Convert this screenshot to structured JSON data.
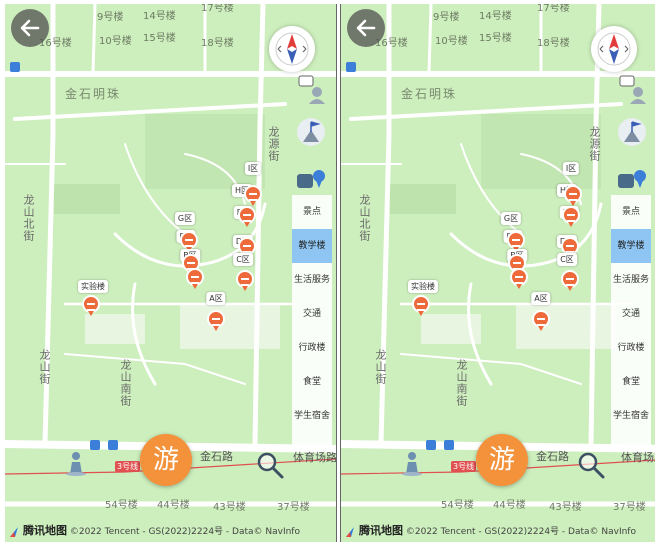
{
  "map": {
    "buildings": [
      "9号楼",
      "14号楼",
      "17号楼",
      "10号楼",
      "15号楼",
      "18号楼",
      "16号楼"
    ],
    "area_name": "金石明珠",
    "streets": {
      "longyuan": "龙源街",
      "longshan_north": "龙山北街",
      "longshan": "龙山街",
      "longshan_south": "龙山南街",
      "jinshi_road": "金石路",
      "tiyu_road": "体育场路"
    },
    "bottom_buildings": [
      "54号楼",
      "44号楼",
      "43号楼",
      "37号楼"
    ],
    "metro_tag": "3号线",
    "pois": [
      {
        "label": "I区"
      },
      {
        "label": "H区"
      },
      {
        "label": "F区"
      },
      {
        "label": "G区"
      },
      {
        "label": "E区"
      },
      {
        "label": "D区"
      },
      {
        "label": "B区"
      },
      {
        "label": "C区"
      },
      {
        "label": "实验楼"
      },
      {
        "label": "A区"
      }
    ]
  },
  "categories": [
    {
      "label": "景点",
      "active": false
    },
    {
      "label": "教学楼",
      "active": true
    },
    {
      "label": "生活服务",
      "active": false
    },
    {
      "label": "交通",
      "active": false
    },
    {
      "label": "行政楼",
      "active": false
    },
    {
      "label": "食堂",
      "active": false
    },
    {
      "label": "学生宿舍",
      "active": false
    }
  ],
  "controls": {
    "tour_button": "游"
  },
  "attribution": {
    "logo": "腾讯地图",
    "text": "©2022 Tencent - GS(2022)2224号 - Data© NavInfo"
  },
  "colors": {
    "map_bg": "#cdeebd",
    "road": "#ffffff",
    "poi": "#ee6a3a",
    "tour_button": "#f3923a",
    "active_category": "#8ec5f2",
    "metro_line": "#e05050"
  }
}
